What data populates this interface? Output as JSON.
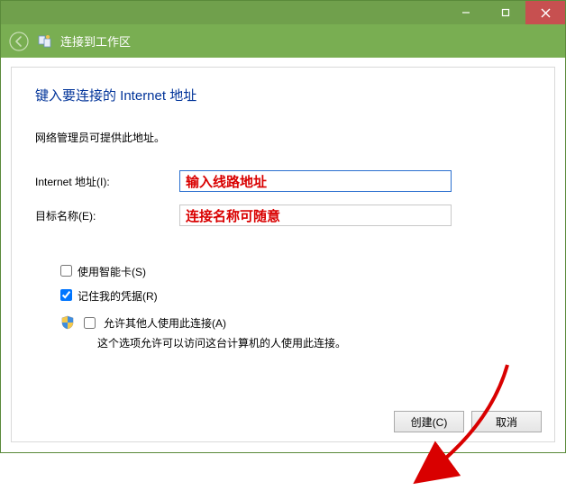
{
  "header": {
    "title": "连接到工作区"
  },
  "main": {
    "title": "键入要连接的 Internet 地址",
    "description": "网络管理员可提供此地址。"
  },
  "form": {
    "internet_label": "Internet 地址(I):",
    "internet_value": "输入线路地址",
    "name_label": "目标名称(E):",
    "name_value": "连接名称可随意"
  },
  "checks": {
    "smartcard": "使用智能卡(S)",
    "remember": "记住我的凭据(R)",
    "allow_others": "允许其他人使用此连接(A)",
    "allow_others_desc": "这个选项允许可以访问这台计算机的人使用此连接。"
  },
  "buttons": {
    "create": "创建(C)",
    "cancel": "取消"
  }
}
